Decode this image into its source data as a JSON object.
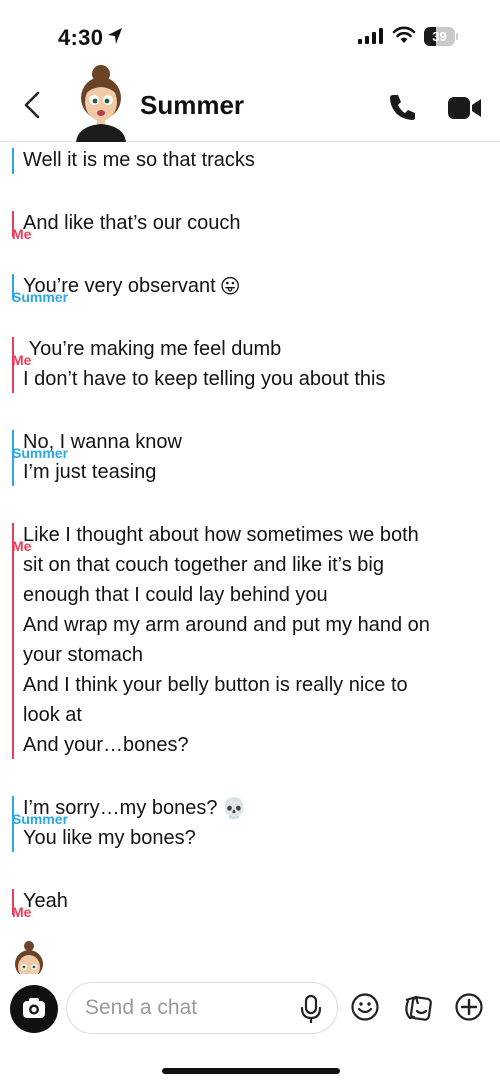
{
  "status_bar": {
    "time": "4:30",
    "battery_level": "39",
    "battery_fraction": 0.39
  },
  "header": {
    "contact_name": "Summer",
    "icons": [
      "back-chevron-icon",
      "bitmoji-avatar",
      "phone-icon",
      "video-icon"
    ]
  },
  "colors": {
    "me": "#ef3b58",
    "summer": "#2aa7e6",
    "text": "#141414"
  },
  "messages": [
    {
      "sender": "",
      "side": "summer",
      "lines": [
        "Well it is me so that tracks"
      ]
    },
    {
      "sender": "Me",
      "side": "me",
      "lines": [
        "And like that’s our couch"
      ]
    },
    {
      "sender": "Summer",
      "side": "summer",
      "lines": [
        "You’re very observant"
      ],
      "emoji": "😛"
    },
    {
      "sender": "Me",
      "side": "me",
      "lines": [
        " You’re making me feel dumb",
        "I don’t have to keep telling you about this"
      ]
    },
    {
      "sender": "Summer",
      "side": "summer",
      "lines": [
        "No, I wanna know",
        "I’m just teasing"
      ]
    },
    {
      "sender": "Me",
      "side": "me",
      "lines": [
        "Like I thought about how sometimes we both",
        "sit on that couch together and like it’s big",
        "enough that I could lay behind you",
        "And wrap my arm around and put my hand on",
        "your stomach",
        "And I think your belly button is really nice to",
        "look at",
        "And your…bones?"
      ]
    },
    {
      "sender": "Summer",
      "side": "summer",
      "lines": [
        "I’m sorry…my bones?",
        "You like my bones?"
      ],
      "emoji": "💀",
      "emoji_line": 0
    },
    {
      "sender": "Me",
      "side": "me",
      "lines": [
        "Yeah"
      ]
    }
  ],
  "input_bar": {
    "placeholder": "Send a chat",
    "icons": [
      "camera-icon",
      "microphone-icon",
      "emoji-icon",
      "sticker-icon",
      "plus-icon"
    ]
  }
}
